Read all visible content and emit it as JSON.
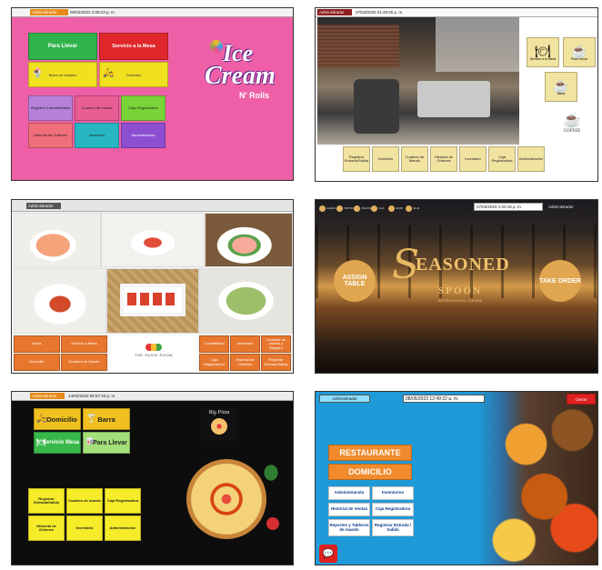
{
  "panel1": {
    "admin_tag": "Administrador",
    "datetime": "06/02/2022 2:59:23 p. m.",
    "btn_llevar": "Para Llevar",
    "btn_mesa": "Servicio a la Mesa",
    "btn_barra": "Barra de helados",
    "btn_domicilio": "Domicilio",
    "btn_registrar": "Registrar Entrada/Salida",
    "btn_cuadres": "Cuadres de mando",
    "btn_caja": "Caja Registradora",
    "btn_historial": "Historial de Ordenes",
    "btn_inventario": "Inventario",
    "btn_admin": "Administración",
    "logo_line1": "Ice",
    "logo_line2": "Cream",
    "logo_line3": "N' Rolls"
  },
  "panel2": {
    "admin_tag": "Administrador",
    "datetime": "27/03/2020 01:48:06 p. m.",
    "btn_mesa": "Servicio a la Mesa",
    "btn_llevar": "Para Llevar",
    "btn_barra": "Barra",
    "logo": "COFFEE",
    "bottom": [
      "Registrar Entrada/Salida",
      "Domicilio",
      "Cuadres de Mando",
      "Historial de Ordenes",
      "Inventario",
      "Caja Registradora",
      "Administración"
    ]
  },
  "panel3": {
    "admin_tag": "Administrador",
    "logo": "THE SUSHI ROOM",
    "bottom_left": [
      "Barra",
      "Servicio a Mesa",
      "Domicilio",
      "Cuadres de Mando"
    ],
    "bottom_right": [
      "Contabilidad",
      "Inventario",
      "Cuadres de mando y Registro",
      "Caja Registradora",
      "Historial de Ordenes",
      "Registrar Entrada/Salida"
    ]
  },
  "panel4": {
    "datetime": "27/03/2019 1:02:16 p. m.",
    "admin_tag": "Administrador",
    "btn_assign": "ASSIGN TABLE",
    "btn_take": "TAKE ORDER",
    "logo_main": "EASONED",
    "logo_s": "S",
    "logo_sub": "SPOON",
    "logo_tag": "INTERNATIONAL CUISINE",
    "icons": [
      "AGENDA",
      "HISTORIAL",
      "INVENTARIO",
      "CAJA",
      "ADMIN",
      "SALIR"
    ]
  },
  "panel5": {
    "admin_tag": "Administrador",
    "datetime": "14/02/2022 05:57:43 p. m.",
    "btn_domicilio": "Domicilio",
    "btn_barra": "Barra",
    "btn_mesa": "Servicio Mesa",
    "btn_llevar": "Para Llevar",
    "logo": "Big Pizza",
    "btn_registrar": "Registrar Entrada/Salida",
    "btn_cuadres": "Cuadres de mando",
    "btn_caja": "Caja Registradora",
    "btn_historial": "Historial de Ordenes",
    "btn_inventario": "Inventario",
    "btn_admin": "Administración"
  },
  "panel6": {
    "admin_tag": "Administrador",
    "datetime": "08/05/2023 12:49:22 a. m.",
    "btn_cerrar": "Cerrar",
    "btn_restaurante": "RESTAURANTE",
    "btn_domicilio": "DOMICILIO",
    "btn_administracion": "Administración",
    "btn_inventarios": "Inventarios",
    "btn_historial": "Historial de Ventas",
    "btn_caja": "Caja Registradora",
    "btn_reportes": "Reportes y Tableros de mando",
    "btn_registrar": "Registrar Entrada / Salida"
  }
}
